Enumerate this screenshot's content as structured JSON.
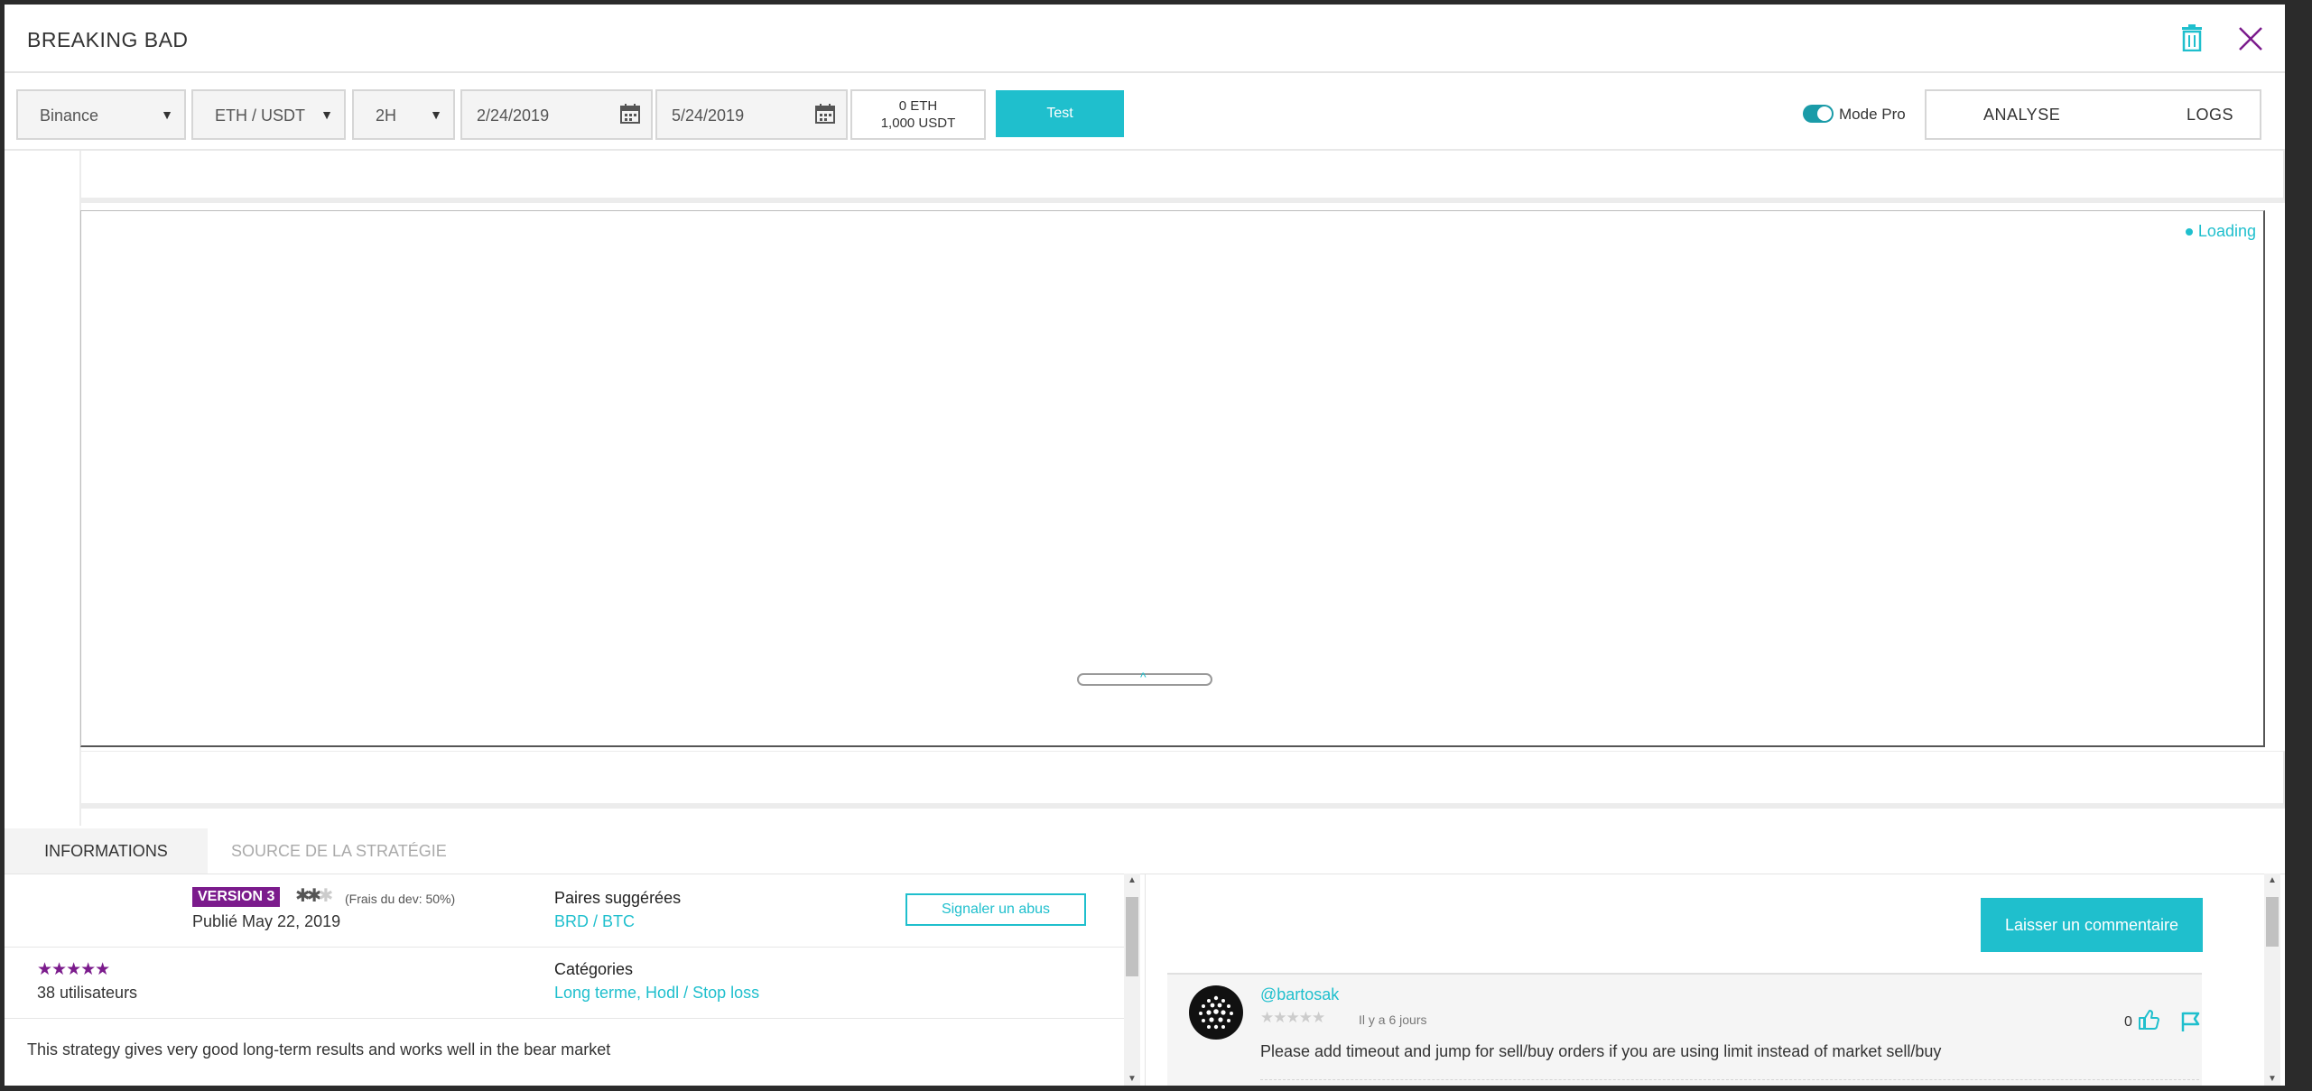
{
  "window": {
    "title": "BREAKING BAD"
  },
  "toolbar": {
    "exchange": "Binance",
    "pair": "ETH / USDT",
    "timeframe": "2H",
    "date_start": "2/24/2019",
    "date_end": "5/24/2019",
    "balance_eth": "0 ETH",
    "balance_usdt": "1,000 USDT",
    "test_label": "Test",
    "mode_label": "Mode Pro",
    "mode_on": true,
    "tab_analyse": "ANALYSE",
    "tab_logs": "LOGS"
  },
  "chart": {
    "loading_label": "Loading"
  },
  "info_tabs": {
    "informations": "INFORMATIONS",
    "source": "SOURCE DE LA STRATÉGIE"
  },
  "info": {
    "version_badge": "VERSION 3",
    "dev_fee": "(Frais du dev: 50%)",
    "published": "Publié May 22, 2019",
    "pairs_heading": "Paires suggérées",
    "pairs_value": "BRD / BTC",
    "report_label": "Signaler un abus",
    "rating_stars": "★★★★★",
    "users": "38 utilisateurs",
    "categories_heading": "Catégories",
    "categories_value": "Long terme, Hodl / Stop loss",
    "description": "This strategy gives very good long-term results and works well in the bear market"
  },
  "comments": {
    "leave_comment_label": "Laisser un commentaire",
    "items": [
      {
        "user": "@bartosak",
        "stars": "★★★★★",
        "time": "Il y a 6 jours",
        "likes": "0",
        "text": "Please add timeout and jump for sell/buy orders if you are using limit instead of market sell/buy"
      }
    ]
  },
  "colors": {
    "accent": "#1fbfcd",
    "badge": "#7b1b8c"
  }
}
